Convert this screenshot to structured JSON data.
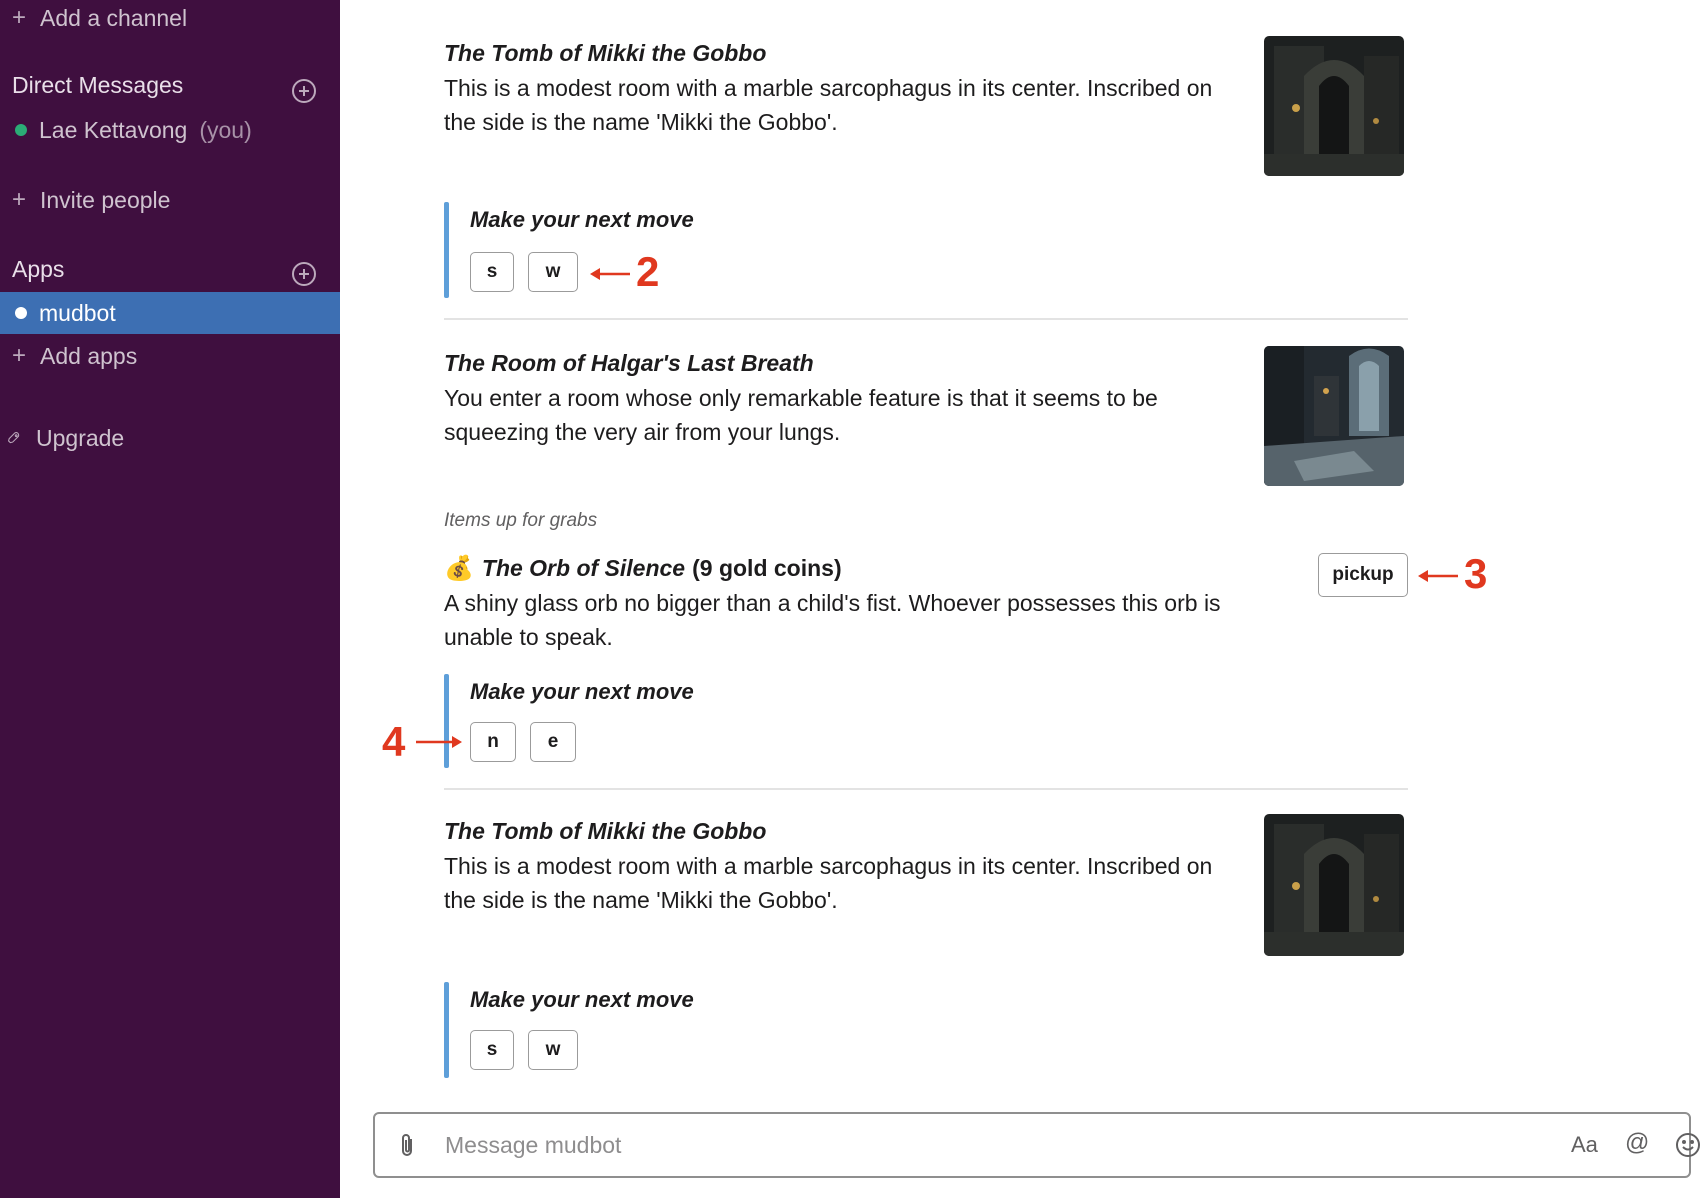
{
  "sidebar": {
    "add_channel": "Add a channel",
    "dm_header": "Direct Messages",
    "dm_user": "Lae Kettavong",
    "dm_you": "(you)",
    "invite": "Invite people",
    "apps_header": "Apps",
    "active_app": "mudbot",
    "add_apps": "Add apps",
    "upgrade": "Upgrade"
  },
  "messages": [
    {
      "title": "The Tomb of Mikki the Gobbo",
      "desc_line1": "This is a modest room with a marble sarcophagus in its center.  Inscribed on",
      "desc_line2": "the side is the name 'Mikki the Gobbo'.",
      "move_title": "Make your next move",
      "buttons": [
        "s",
        "w"
      ]
    },
    {
      "title": "The Room of Halgar's Last Breath",
      "desc_line1": "You enter a room whose only remarkable feature is that it seems to be",
      "desc_line2": "squeezing the very air from your lungs.",
      "grabs_label": "Items up for grabs",
      "item_emoji": "💰",
      "item_title": "The Orb of Silence",
      "item_suffix": "(9 gold coins)",
      "item_desc_line1": "A shiny glass orb no bigger than a child's fist.  Whoever possesses this orb is",
      "item_desc_line2": "unable to speak.",
      "pickup_label": "pickup",
      "move_title": "Make your next move",
      "buttons": [
        "n",
        "e"
      ]
    },
    {
      "title": "The Tomb of Mikki the Gobbo",
      "desc_line1": "This is a modest room with a marble sarcophagus in its center.  Inscribed on",
      "desc_line2": "the side is the name 'Mikki the Gobbo'.",
      "move_title": "Make your next move",
      "buttons": [
        "s",
        "w"
      ]
    }
  ],
  "annotations": [
    "2",
    "3",
    "4"
  ],
  "composer": {
    "placeholder": "Message mudbot",
    "format_label": "Aa",
    "mention_label": "@"
  },
  "colors": {
    "sidebar_bg": "#3f0f3f",
    "active_bg": "#3d6fb3",
    "attachment_bar": "#5e9fd9",
    "annotation": "#e0381f",
    "presence": "#2bac76"
  },
  "icons": [
    "plus-icon",
    "add-circle-icon",
    "presence-dot-icon",
    "rocket-icon",
    "paperclip-icon",
    "at-icon",
    "emoji-icon",
    "money-bag-icon",
    "arrow-left-icon",
    "arrow-right-icon"
  ]
}
